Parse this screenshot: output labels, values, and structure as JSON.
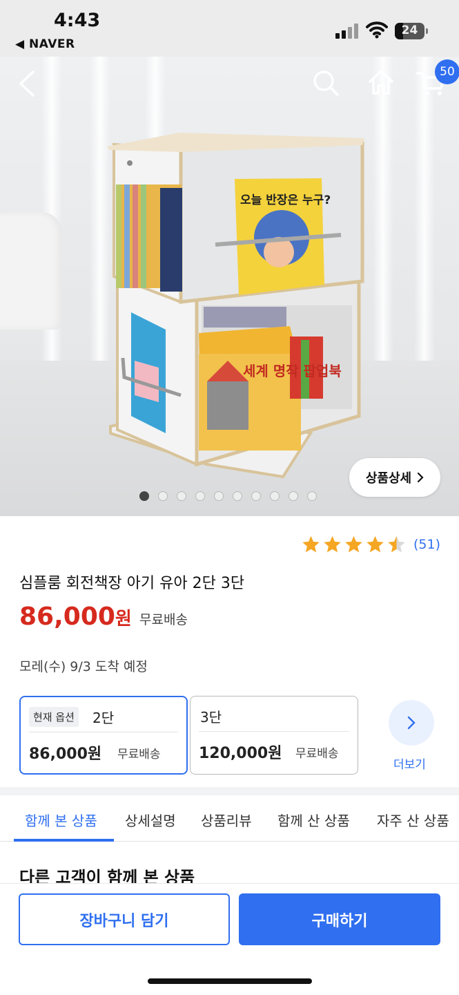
{
  "status_bar": {
    "time": "4:43",
    "back_app": "◀ NAVER",
    "battery": "24"
  },
  "header": {
    "cart_count": "50",
    "icons": [
      "back-icon",
      "search-icon",
      "home-icon",
      "cart-icon"
    ]
  },
  "gallery": {
    "detail_button_label": "상품상세",
    "image_count": 10,
    "current_index": 1,
    "book1_title": "오늘 반장은 누구?",
    "book2_title": "세계 명작 팝업북"
  },
  "product": {
    "rating": 4.5,
    "rating_count": "(51)",
    "title": "심플룸 회전책장 아기 유아 2단 3단",
    "price_number": "86,000",
    "price_unit": "원",
    "shipping": "무료배송",
    "arrival": "모레(수) 9/3 도착 예정"
  },
  "options": {
    "current_tag": "현재 옵션",
    "items": [
      {
        "name": "2단",
        "price": "86,000원",
        "shipping": "무료배송"
      },
      {
        "name": "3단",
        "price": "120,000원",
        "shipping": "무료배송"
      }
    ],
    "more_label": "더보기"
  },
  "tabs": {
    "items": [
      "함께 본 상품",
      "상세설명",
      "상품리뷰",
      "함께 산 상품",
      "자주 산 상품"
    ],
    "active_index": 0
  },
  "section_title": "다른 고객이 함께 본 상품",
  "actions": {
    "cart_label": "장바구니 담기",
    "buy_label": "구매하기"
  },
  "colors": {
    "accent": "#2f6ff0",
    "price": "#d62a1e",
    "star": "#f5a623"
  }
}
